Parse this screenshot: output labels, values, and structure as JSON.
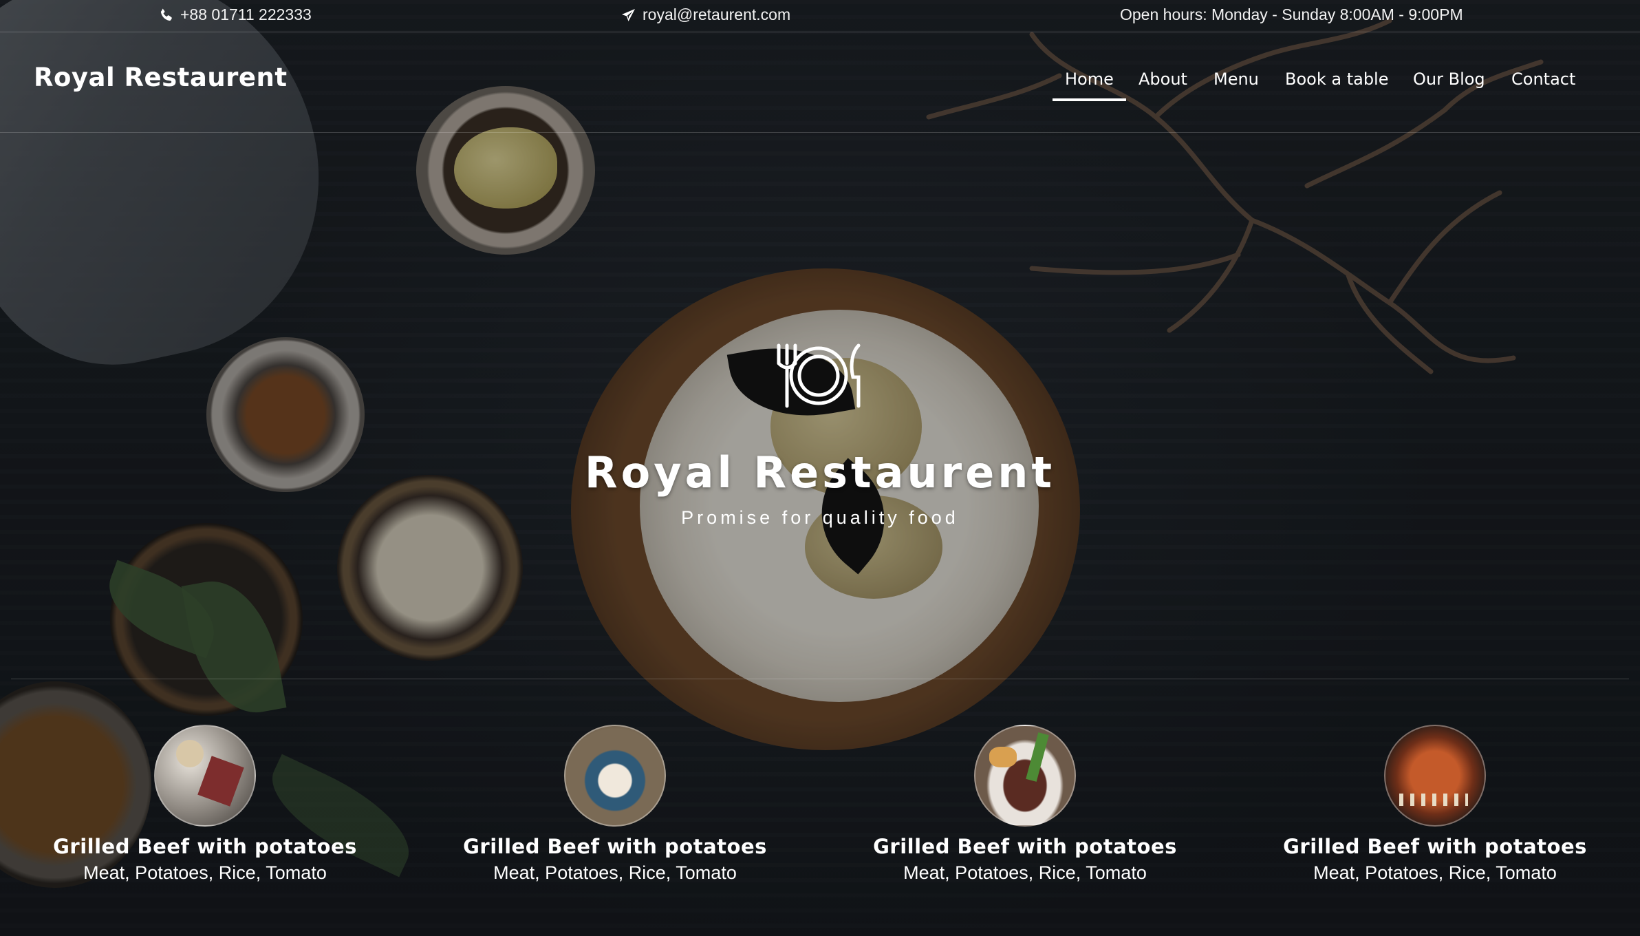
{
  "topbar": {
    "phone": "+88 01711 222333",
    "email": "royal@retaurent.com",
    "hours": "Open hours: Monday - Sunday 8:00AM - 9:00PM"
  },
  "brand": "Royal Restaurent",
  "nav": {
    "items": [
      {
        "label": "Home",
        "active": true
      },
      {
        "label": "About",
        "active": false
      },
      {
        "label": "Menu",
        "active": false
      },
      {
        "label": "Book a table",
        "active": false
      },
      {
        "label": "Our Blog",
        "active": false
      },
      {
        "label": "Contact",
        "active": false
      }
    ]
  },
  "hero": {
    "icon": "plate-fork-knife-icon",
    "title": "Royal Restaurent",
    "subtitle": "Promise for quality food"
  },
  "dishes": [
    {
      "name": "Grilled Beef with potatoes",
      "ingredients": "Meat, Potatoes, Rice, Tomato"
    },
    {
      "name": "Grilled Beef with potatoes",
      "ingredients": "Meat, Potatoes, Rice, Tomato"
    },
    {
      "name": "Grilled Beef with potatoes",
      "ingredients": "Meat, Potatoes, Rice, Tomato"
    },
    {
      "name": "Grilled Beef with potatoes",
      "ingredients": "Meat, Potatoes, Rice, Tomato"
    }
  ],
  "colors": {
    "text": "#ffffff",
    "background": "#242a31"
  }
}
